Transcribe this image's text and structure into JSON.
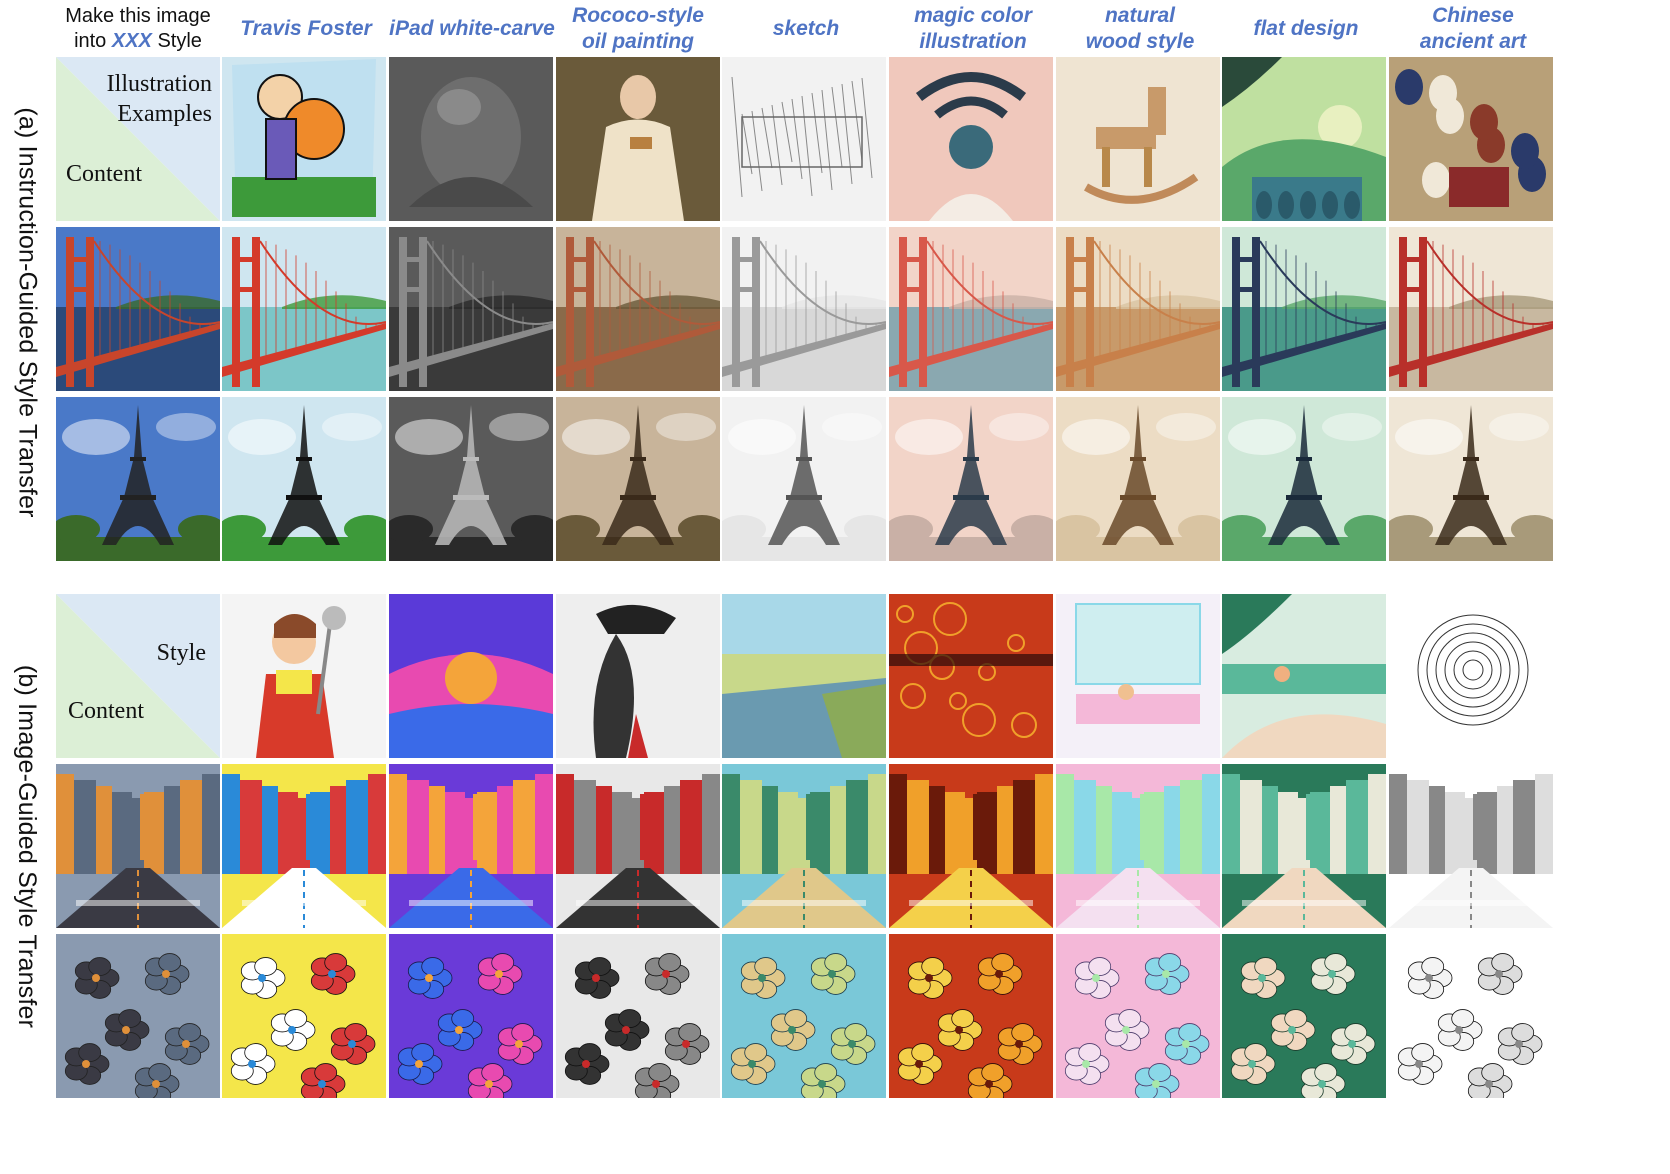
{
  "header_instruction": {
    "line1": "Make this image",
    "line2_prefix": "into ",
    "line2_emph": "XXX",
    "line2_suffix": " Style"
  },
  "side_labels": {
    "a": "(a) Instruction-Guided Style Transfer",
    "b": "(b) Image-Guided Style Transfer"
  },
  "legend_a": {
    "top": "Illustration Examples",
    "top_line1": "Illustration",
    "top_line2": "Examples",
    "bottom": "Content"
  },
  "legend_b": {
    "top": "Style",
    "bottom": "Content"
  },
  "styles": [
    {
      "line1": "Travis Foster",
      "line2": ""
    },
    {
      "line1": "iPad white-carve",
      "line2": ""
    },
    {
      "line1": "Rococo-style",
      "line2": "oil painting"
    },
    {
      "line1": "sketch",
      "line2": ""
    },
    {
      "line1": "magic color",
      "line2": "illustration"
    },
    {
      "line1": "natural",
      "line2": "wood style"
    },
    {
      "line1": "flat design",
      "line2": ""
    },
    {
      "line1": "Chinese",
      "line2": "ancient art"
    }
  ],
  "colors": {
    "header_blue": "#4f74c4",
    "legend_green": "#dcefd6",
    "legend_blue": "#dbe8f4"
  }
}
